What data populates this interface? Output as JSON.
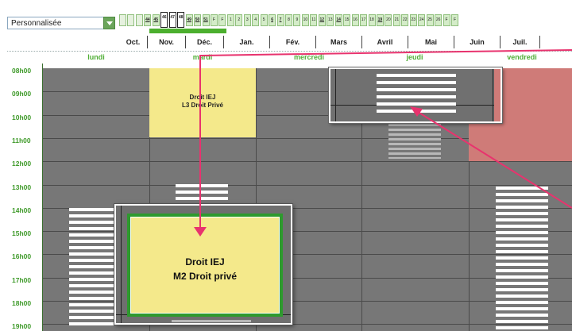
{
  "view_select": {
    "value": "Personnalisée"
  },
  "weeks": [
    "",
    "",
    "",
    "44",
    "45",
    "46",
    "47",
    "48",
    "49",
    "50",
    "51",
    "F",
    "F",
    "1",
    "2",
    "3",
    "4",
    "5",
    "6",
    "7",
    "8",
    "9",
    "10",
    "11",
    "12",
    "13",
    "14",
    "15",
    "16",
    "17",
    "18",
    "19",
    "20",
    "21",
    "22",
    "23",
    "24",
    "25",
    "26",
    "F",
    "F"
  ],
  "weeks_selected": [
    "46",
    "47",
    "48"
  ],
  "weeks_underlined": [
    "44",
    "45",
    "49",
    "50",
    "51",
    "6",
    "7",
    "12",
    "14",
    "19"
  ],
  "months": [
    "Oct.",
    "Nov.",
    "Déc.",
    "Jan.",
    "Fév.",
    "Mars",
    "Avril",
    "Mai",
    "Juin",
    "Juil."
  ],
  "days": [
    "lundi",
    "mardi",
    "mercredi",
    "jeudi",
    "vendredi"
  ],
  "hours": [
    "08h00",
    "09h00",
    "10h00",
    "11h00",
    "12h00",
    "13h00",
    "14h00",
    "15h00",
    "16h00",
    "17h00",
    "18h00",
    "19h00"
  ],
  "courses": {
    "tuesday_morning": {
      "line1": "Droit IEJ",
      "line2": "L3 Droit Privé"
    },
    "zoomed": {
      "line1": "Droit IEJ",
      "line2": "M2 Droit privé"
    }
  },
  "colors": {
    "green_accent": "#4caf2e",
    "course_yellow": "#f4e98b",
    "blocked_red": "#cf7b78",
    "grid_grey": "#777777",
    "arrow_pink": "#e8336e"
  }
}
